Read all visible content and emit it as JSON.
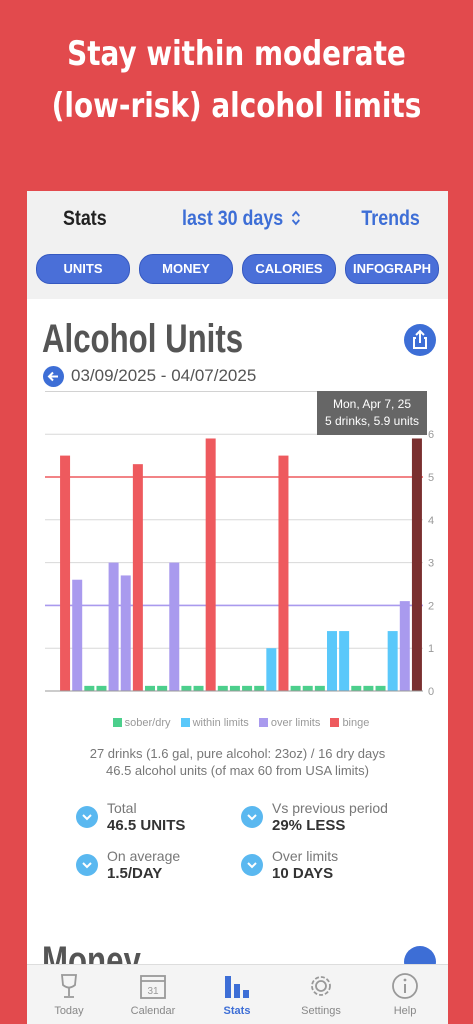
{
  "headline": {
    "line1": "Stay within moderate",
    "line2": "(low-risk) alcohol limits"
  },
  "nav": {
    "stats": "Stats",
    "period": "last 30 days",
    "trends": "Trends"
  },
  "tabs": [
    "UNITS",
    "MONEY",
    "CALORIES",
    "INFOGRAPH"
  ],
  "section": {
    "title": "Alcohol Units",
    "date_range": "03/09/2025 - 04/07/2025"
  },
  "tooltip": {
    "line1": "Mon, Apr 7, 25",
    "line2": "5 drinks, 5.9 units"
  },
  "chart_data": {
    "type": "bar",
    "ylim": [
      0,
      7
    ],
    "y_ticks": [
      "0",
      "1",
      "2",
      "3",
      "4",
      "5",
      "6"
    ],
    "limit_lines": {
      "binge": 5,
      "over_limits": 2
    },
    "legend": [
      {
        "label": "sober/dry",
        "color": "#4ccf8c"
      },
      {
        "label": "within limits",
        "color": "#5ac8fa"
      },
      {
        "label": "over limits",
        "color": "#a99aee"
      },
      {
        "label": "binge",
        "color": "#ee5a5e"
      }
    ],
    "values": [
      5.5,
      2.6,
      0.12,
      0.12,
      3.0,
      2.7,
      5.3,
      0.12,
      0.12,
      3.0,
      0.12,
      0.12,
      5.9,
      0.12,
      0.12,
      0.12,
      0.12,
      1.0,
      5.5,
      0.12,
      0.12,
      0.12,
      1.4,
      1.4,
      0.12,
      0.12,
      0.12,
      1.4,
      2.1,
      5.9
    ],
    "categories": [
      "binge",
      "over",
      "dry",
      "dry",
      "over",
      "over",
      "binge",
      "dry",
      "dry",
      "over",
      "dry",
      "dry",
      "binge",
      "dry",
      "dry",
      "dry",
      "dry",
      "within",
      "binge",
      "dry",
      "dry",
      "dry",
      "within",
      "within",
      "dry",
      "dry",
      "dry",
      "within",
      "over",
      "selected"
    ],
    "selected_color": "#7a2f2f"
  },
  "summary": {
    "line1": "27 drinks (1.6 gal, pure alcohol: 23oz) / 16 dry days",
    "line2": "46.5 alcohol units (of max 60 from USA limits)"
  },
  "stats": [
    {
      "label": "Total",
      "value": "46.5 UNITS"
    },
    {
      "label": "Vs previous period",
      "value": "29% LESS"
    },
    {
      "label": "On average",
      "value": "1.5/DAY"
    },
    {
      "label": "Over limits",
      "value": "10 DAYS"
    }
  ],
  "money": {
    "title": "Money"
  },
  "bottom_nav": [
    {
      "label": "Today",
      "icon": "glass-icon"
    },
    {
      "label": "Calendar",
      "icon": "calendar-icon",
      "day": "31"
    },
    {
      "label": "Stats",
      "icon": "bar-chart-icon",
      "active": true
    },
    {
      "label": "Settings",
      "icon": "gear-icon"
    },
    {
      "label": "Help",
      "icon": "info-icon"
    }
  ],
  "colors": {
    "accent": "#3d6ed6",
    "background": "#e24a4d"
  }
}
